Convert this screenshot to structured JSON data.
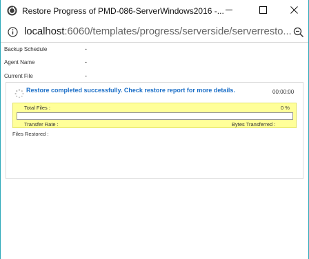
{
  "window": {
    "title": "Restore Progress of PMD-086-ServerWindows2016 -..."
  },
  "address_bar": {
    "host": "localhost",
    "path": ":6060/templates/progress/serverside/serverresto..."
  },
  "icons": {
    "app": "restore-app-icon",
    "info": "info-icon",
    "zoom": "zoom-out-icon",
    "spinner": "spinner-icon"
  },
  "info": {
    "backup_schedule_label": "Backup Schedule",
    "backup_schedule_value": "-",
    "agent_name_label": "Agent Name",
    "agent_name_value": "-",
    "current_file_label": "Current File",
    "current_file_value": "-"
  },
  "progress": {
    "status_message": "Restore completed successfully. Check restore report for more details.",
    "elapsed_time": "00:00:00",
    "total_files_label": "Total Files :",
    "percent_text": "0 %",
    "percent_value": 0,
    "transfer_rate_label": "Transfer Rate :",
    "bytes_transferred_label": "Bytes Transferred :",
    "files_restored_label": "Files Restored :"
  },
  "colors": {
    "accent_border": "#2aa7b8",
    "status_text": "#1a6ec7",
    "progress_box_bg": "#ffff99",
    "progress_fill": "#4c9be8"
  }
}
